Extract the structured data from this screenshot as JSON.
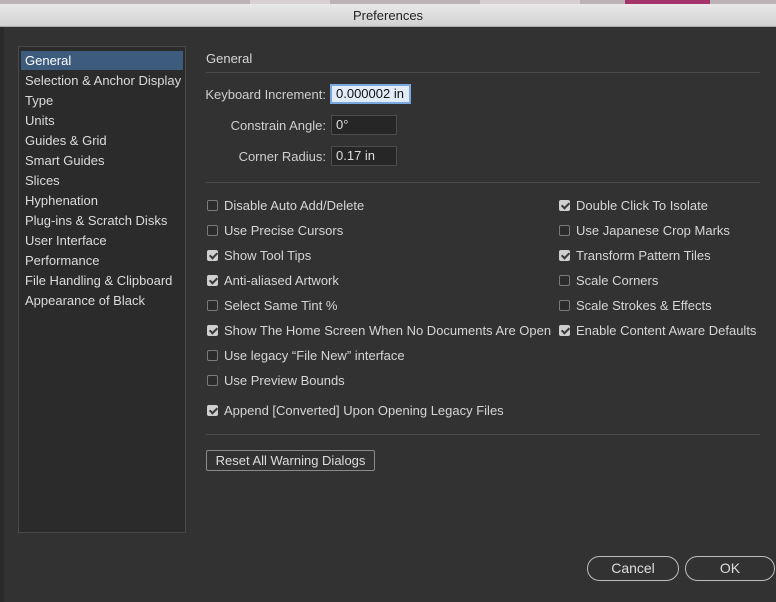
{
  "window": {
    "title": "Preferences"
  },
  "sidebar": {
    "items": [
      {
        "label": "General",
        "selected": true
      },
      {
        "label": "Selection & Anchor Display",
        "selected": false
      },
      {
        "label": "Type",
        "selected": false
      },
      {
        "label": "Units",
        "selected": false
      },
      {
        "label": "Guides & Grid",
        "selected": false
      },
      {
        "label": "Smart Guides",
        "selected": false
      },
      {
        "label": "Slices",
        "selected": false
      },
      {
        "label": "Hyphenation",
        "selected": false
      },
      {
        "label": "Plug-ins & Scratch Disks",
        "selected": false
      },
      {
        "label": "User Interface",
        "selected": false
      },
      {
        "label": "Performance",
        "selected": false
      },
      {
        "label": "File Handling & Clipboard",
        "selected": false
      },
      {
        "label": "Appearance of Black",
        "selected": false
      }
    ]
  },
  "main": {
    "section_title": "General",
    "fields": [
      {
        "label": "Keyboard Increment:",
        "value": "0.000002 in"
      },
      {
        "label": "Constrain Angle:",
        "value": "0°"
      },
      {
        "label": "Corner Radius:",
        "value": "0.17 in"
      }
    ],
    "left_options": [
      {
        "label": "Disable Auto Add/Delete",
        "checked": false
      },
      {
        "label": "Use Precise Cursors",
        "checked": false
      },
      {
        "label": "Show Tool Tips",
        "checked": true
      },
      {
        "label": "Anti-aliased Artwork",
        "checked": true
      },
      {
        "label": "Select Same Tint %",
        "checked": false
      },
      {
        "label": "Show The Home Screen When No Documents Are Open",
        "checked": true
      },
      {
        "label": "Use legacy “File New” interface",
        "checked": false
      },
      {
        "label": "Use Preview Bounds",
        "checked": false
      }
    ],
    "right_options": [
      {
        "label": "Double Click To Isolate",
        "checked": true
      },
      {
        "label": "Use Japanese Crop Marks",
        "checked": false
      },
      {
        "label": "Transform Pattern Tiles",
        "checked": true
      },
      {
        "label": "Scale Corners",
        "checked": false
      },
      {
        "label": "Scale Strokes & Effects",
        "checked": false
      },
      {
        "label": "Enable Content Aware Defaults",
        "checked": true
      }
    ],
    "bottom_option": {
      "label": "Append [Converted] Upon Opening Legacy Files",
      "checked": true
    },
    "reset_button": "Reset All Warning Dialogs"
  },
  "footer": {
    "cancel_label": "Cancel",
    "ok_label": "OK"
  }
}
